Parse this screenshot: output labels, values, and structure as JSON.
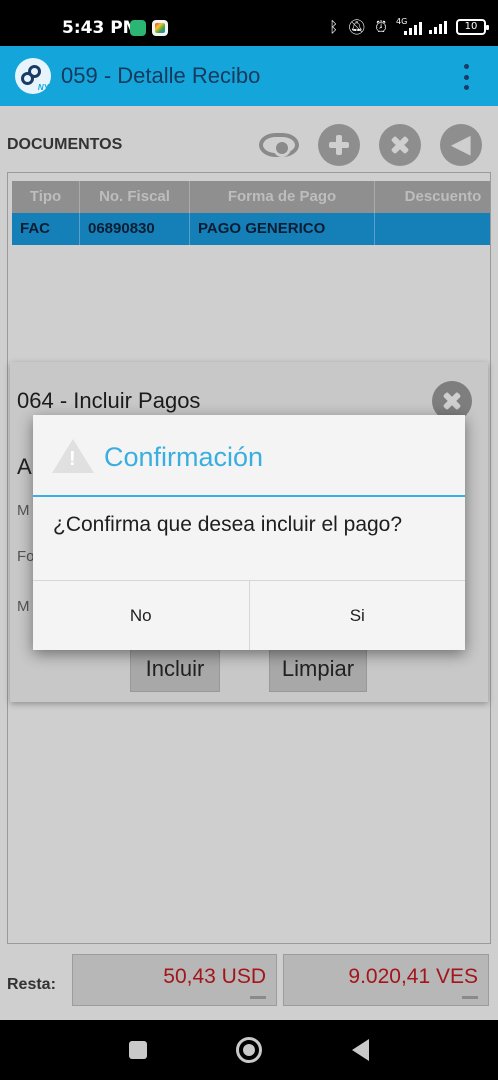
{
  "status_bar": {
    "time": "5:43 PM",
    "network_label": "4G",
    "battery": "10"
  },
  "app_bar": {
    "title": "059 - Detalle Recibo",
    "logo_tag": "NY"
  },
  "documents": {
    "title": "DOCUMENTOS",
    "toolbar_icons": [
      "eye-icon",
      "plus-icon",
      "close-icon",
      "arrow-left-icon"
    ],
    "columns": [
      "Tipo",
      "No. Fiscal",
      "Forma de Pago",
      "Descuento"
    ],
    "rows": [
      {
        "tipo": "FAC",
        "no_fiscal": "06890830",
        "forma_pago": "PAGO GENERICO",
        "descuento": ""
      }
    ]
  },
  "totals": {
    "label": "Resta:",
    "usd": "50,43 USD",
    "ves": "9.020,41 VES"
  },
  "include_payments_dialog": {
    "title": "064 - Incluir Pagos",
    "fragments": [
      "A",
      "M",
      "Fo",
      "M"
    ],
    "include_button": "Incluir",
    "clear_button": "Limpiar"
  },
  "confirm_dialog": {
    "title": "Confirmación",
    "message": "¿Confirma que desea incluir el pago?",
    "no_label": "No",
    "yes_label": "Si"
  },
  "colors": {
    "app_bar": "#14a6db",
    "accent": "#3aaee0",
    "selected_row": "#1580b8",
    "amount_text": "#a3151a"
  }
}
